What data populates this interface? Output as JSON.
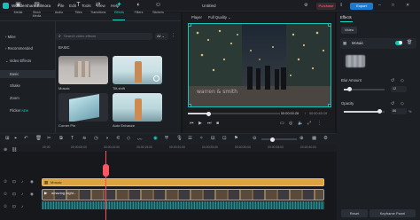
{
  "app": {
    "name": "Wondershare Filmora",
    "document_title": "Untitled",
    "menu": [
      "File",
      "Edit",
      "Tools",
      "View",
      "Help"
    ],
    "purchase_label": "Purchase",
    "export_label": "Export"
  },
  "toolbar_tabs": [
    {
      "label": "Media",
      "icon": "media-icon"
    },
    {
      "label": "Stock Media",
      "icon": "stock-media-icon"
    },
    {
      "label": "Audio",
      "icon": "audio-icon"
    },
    {
      "label": "Titles",
      "icon": "titles-icon"
    },
    {
      "label": "Transitions",
      "icon": "transitions-icon"
    },
    {
      "label": "Effects",
      "icon": "effects-icon",
      "active": true
    },
    {
      "label": "Filters",
      "icon": "filters-icon"
    },
    {
      "label": "Stickers",
      "icon": "stickers-icon"
    }
  ],
  "sidebar": {
    "items": [
      "Mine",
      "Recommended",
      "Video Effects",
      "Basic",
      "Shake",
      "Zoom",
      "Flicker"
    ],
    "flicker_badge": "NEW"
  },
  "library": {
    "search_placeholder": "Search video effects",
    "filter_value": "All",
    "section_label": "BASIC",
    "effects": [
      {
        "name": "Mosaic"
      },
      {
        "name": "Tilt-shift"
      },
      {
        "name": "Corner Pin"
      },
      {
        "name": "Auto Enhance"
      }
    ]
  },
  "player": {
    "label": "Player",
    "quality": "Full Quality",
    "watermark": "warren & smith",
    "current_time": "00:00:00:28",
    "total_time": "00:00:45:19",
    "progress_fraction": 0.22
  },
  "effects_panel": {
    "tab": "Effects",
    "chip": "Video",
    "effect_name": "Mosaic",
    "blur_label": "Blur Amount",
    "blur_value": "12",
    "blur_fraction": 0.12,
    "opacity_label": "Opacity",
    "opacity_value": "86",
    "opacity_unit": "%",
    "opacity_fraction": 0.86,
    "reset_label": "Reset",
    "keyframe_label": "Keyframe Panel"
  },
  "timeline": {
    "ruler": [
      "00:00",
      "00:00:05:00",
      "00:00:10:00",
      "00:00:15:00",
      "00:00:20:00",
      "00:00:25:00",
      "00:00:30:00",
      "00:00:35:00",
      "00:00:40:00"
    ],
    "tracks": [
      {
        "label": "②"
      },
      {
        "label": "①"
      },
      {
        "label": "①"
      }
    ],
    "effect_clip": "Mosaic",
    "video_clip": "amazing night..."
  },
  "colors": {
    "accent": "#16d6c4",
    "export": "#1b7bd1",
    "playhead": "#ff4f5a",
    "effect_clip": "#d9a441"
  }
}
